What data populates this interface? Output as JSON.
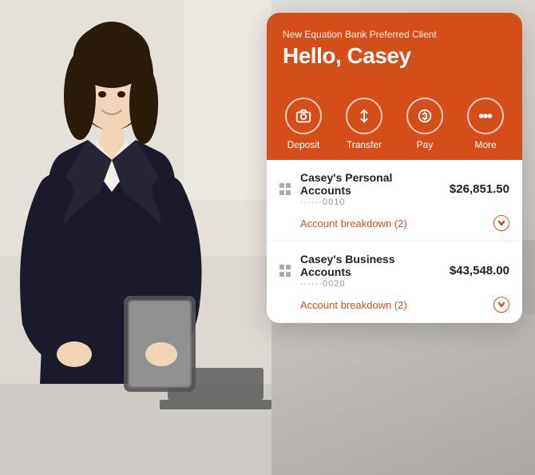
{
  "header": {
    "subtitle": "New Equation Bank Preferred Client",
    "greeting": "Hello, Casey"
  },
  "actions": [
    {
      "id": "deposit",
      "label": "Deposit",
      "icon": "camera-icon"
    },
    {
      "id": "transfer",
      "label": "Transfer",
      "icon": "transfer-icon"
    },
    {
      "id": "pay",
      "label": "Pay",
      "icon": "pay-icon"
    },
    {
      "id": "more",
      "label": "More",
      "icon": "more-icon"
    }
  ],
  "accounts": [
    {
      "name": "Casey's Personal Accounts",
      "account_number": "······0010",
      "balance": "$26,851.50",
      "breakdown_label": "Account breakdown (2)"
    },
    {
      "name": "Casey's Business Accounts",
      "account_number": "······0020",
      "balance": "$43,548.00",
      "breakdown_label": "Account breakdown (2)"
    }
  ],
  "colors": {
    "primary": "#d44e1a",
    "text_dark": "#222222",
    "text_muted": "#999999"
  }
}
